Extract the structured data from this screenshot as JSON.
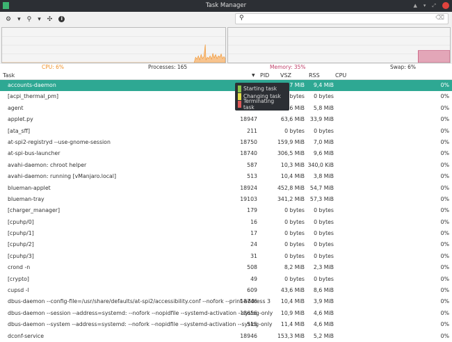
{
  "window": {
    "title": "Task Manager"
  },
  "toolbar": {
    "settings": "⚙",
    "settings_drop": "▾",
    "tree": "⚲",
    "tree_drop": "▾",
    "move": "✣",
    "info": "i"
  },
  "search": {
    "placeholder": "",
    "value": ""
  },
  "stats": {
    "cpu": "CPU: 6%",
    "processes": "Processes: 165",
    "memory": "Memory: 35%",
    "swap": "Swap: 6%"
  },
  "colors": {
    "cpu": "#f0922a",
    "memory": "#c0416a",
    "selection": "#2ea893"
  },
  "columns": {
    "task": "Task",
    "pid": "PID",
    "vsz": "VSZ",
    "rss": "RSS",
    "cpu": "CPU"
  },
  "tooltip": {
    "items": [
      {
        "label": "Starting task",
        "color": "#8bc34a"
      },
      {
        "label": "Changing task",
        "color": "#e6e04a"
      },
      {
        "label": "Terminating task",
        "color": "#e05a5a"
      }
    ]
  },
  "rows": [
    {
      "name": "accounts-daemon",
      "pid": "",
      "vsz": "9,7 MiB",
      "rss": "9,4 MiB",
      "cpu": "0%"
    },
    {
      "name": "[acpi_thermal_pm]",
      "pid": "",
      "vsz": "0 bytes",
      "rss": "0 bytes",
      "cpu": "0%"
    },
    {
      "name": "agent",
      "pid": "",
      "vsz": "9,6 MiB",
      "rss": "5,8 MiB",
      "cpu": "0%"
    },
    {
      "name": "applet.py",
      "pid": "18947",
      "vsz": "63,6 MiB",
      "rss": "33,9 MiB",
      "cpu": "0%"
    },
    {
      "name": "[ata_sff]",
      "pid": "211",
      "vsz": "0 bytes",
      "rss": "0 bytes",
      "cpu": "0%"
    },
    {
      "name": "at-spi2-registryd --use-gnome-session",
      "pid": "18750",
      "vsz": "159,9 MiB",
      "rss": "7,0 MiB",
      "cpu": "0%"
    },
    {
      "name": "at-spi-bus-launcher",
      "pid": "18740",
      "vsz": "306,5 MiB",
      "rss": "9,6 MiB",
      "cpu": "0%"
    },
    {
      "name": "avahi-daemon: chroot helper",
      "pid": "587",
      "vsz": "10,3 MiB",
      "rss": "340,0 KiB",
      "cpu": "0%"
    },
    {
      "name": "avahi-daemon: running [vManjaro.local]",
      "pid": "513",
      "vsz": "10,4 MiB",
      "rss": "3,8 MiB",
      "cpu": "0%"
    },
    {
      "name": "blueman-applet",
      "pid": "18924",
      "vsz": "452,8 MiB",
      "rss": "54,7 MiB",
      "cpu": "0%"
    },
    {
      "name": "blueman-tray",
      "pid": "19103",
      "vsz": "341,2 MiB",
      "rss": "57,3 MiB",
      "cpu": "0%"
    },
    {
      "name": "[charger_manager]",
      "pid": "179",
      "vsz": "0 bytes",
      "rss": "0 bytes",
      "cpu": "0%"
    },
    {
      "name": "[cpuhp/0]",
      "pid": "16",
      "vsz": "0 bytes",
      "rss": "0 bytes",
      "cpu": "0%"
    },
    {
      "name": "[cpuhp/1]",
      "pid": "17",
      "vsz": "0 bytes",
      "rss": "0 bytes",
      "cpu": "0%"
    },
    {
      "name": "[cpuhp/2]",
      "pid": "24",
      "vsz": "0 bytes",
      "rss": "0 bytes",
      "cpu": "0%"
    },
    {
      "name": "[cpuhp/3]",
      "pid": "31",
      "vsz": "0 bytes",
      "rss": "0 bytes",
      "cpu": "0%"
    },
    {
      "name": "crond -n",
      "pid": "508",
      "vsz": "8,2 MiB",
      "rss": "2,3 MiB",
      "cpu": "0%"
    },
    {
      "name": "[crypto]",
      "pid": "49",
      "vsz": "0 bytes",
      "rss": "0 bytes",
      "cpu": "0%"
    },
    {
      "name": "cupsd -l",
      "pid": "609",
      "vsz": "43,6 MiB",
      "rss": "8,6 MiB",
      "cpu": "0%"
    },
    {
      "name": "dbus-daemon --config-file=/usr/share/defaults/at-spi2/accessibility.conf --nofork --print-address 3",
      "pid": "18746",
      "vsz": "10,4 MiB",
      "rss": "3,9 MiB",
      "cpu": "0%"
    },
    {
      "name": "dbus-daemon --session --address=systemd: --nofork --nopidfile --systemd-activation --syslog-only",
      "pid": "18656",
      "vsz": "10,9 MiB",
      "rss": "4,6 MiB",
      "cpu": "0%"
    },
    {
      "name": "dbus-daemon --system --address=systemd: --nofork --nopidfile --systemd-activation --syslog-only",
      "pid": "515",
      "vsz": "11,4 MiB",
      "rss": "4,6 MiB",
      "cpu": "0%"
    },
    {
      "name": "dconf-service",
      "pid": "18946",
      "vsz": "153,3 MiB",
      "rss": "5,2 MiB",
      "cpu": "0%"
    }
  ]
}
